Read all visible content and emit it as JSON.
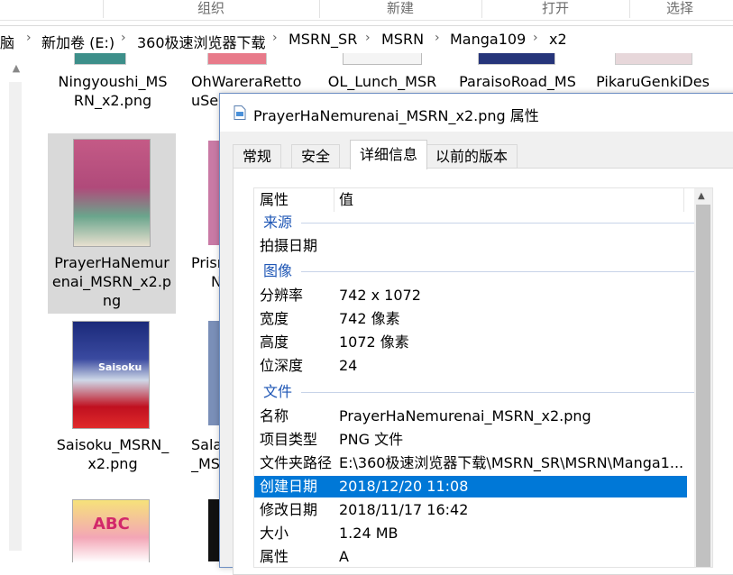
{
  "ribbon": {
    "groups": [
      "组织",
      "新建",
      "打开",
      "选择"
    ]
  },
  "address": {
    "crumbs": [
      "脑",
      "新加卷 (E:)",
      "360极速浏览器下载",
      "MSRN_SR",
      "MSRN",
      "Manga109",
      "x2"
    ]
  },
  "files": [
    {
      "name_lines": [
        "Ningyoushi_MS",
        "RN_x2.png"
      ]
    },
    {
      "name_lines": [
        "OhWareraRetto",
        "uSei"
      ]
    },
    {
      "name_lines": [
        "OL_Lunch_MSR"
      ]
    },
    {
      "name_lines": [
        "ParaisoRoad_MS"
      ]
    },
    {
      "name_lines": [
        "PikaruGenkiDes"
      ]
    },
    {
      "name_lines": [
        "PrayerHaNemur",
        "enai_MSRN_x2.p",
        "ng"
      ]
    },
    {
      "name_lines": [
        "Prism",
        "N"
      ]
    },
    {
      "name_lines": [
        "Saisoku_MSRN_",
        "x2.png"
      ]
    },
    {
      "name_lines": [
        "Sala",
        "_MS"
      ]
    }
  ],
  "thumb_text": {
    "saisoku_sub": "Saisoku",
    "abc": "ABC"
  },
  "dialog": {
    "title": "PrayerHaNemurenai_MSRN_x2.png 属性",
    "tabs": [
      "常规",
      "安全",
      "详细信息",
      "以前的版本"
    ],
    "active_tab": 2,
    "columns": {
      "property": "属性",
      "value": "值"
    },
    "groups": {
      "origin": "来源",
      "image": "图像",
      "file": "文件"
    },
    "rows": {
      "taken": {
        "k": "拍摄日期",
        "v": ""
      },
      "resolution": {
        "k": "分辨率",
        "v": "742 x 1072"
      },
      "width": {
        "k": "宽度",
        "v": "742 像素"
      },
      "height": {
        "k": "高度",
        "v": "1072 像素"
      },
      "depth": {
        "k": "位深度",
        "v": "24"
      },
      "name": {
        "k": "名称",
        "v": "PrayerHaNemurenai_MSRN_x2.png"
      },
      "type": {
        "k": "项目类型",
        "v": "PNG 文件"
      },
      "path": {
        "k": "文件夹路径",
        "v": "E:\\360极速浏览器下载\\MSRN_SR\\MSRN\\Manga1..."
      },
      "created": {
        "k": "创建日期",
        "v": "2018/12/20 11:08"
      },
      "modified": {
        "k": "修改日期",
        "v": "2018/11/17 16:42"
      },
      "size": {
        "k": "大小",
        "v": "1.24 MB"
      },
      "attr": {
        "k": "属性",
        "v": "A"
      }
    },
    "selected_row": "created"
  },
  "colors": {
    "accent": "#0078d7",
    "group_text": "#1e56b5",
    "file_selected_bg": "#d9d9d9"
  }
}
